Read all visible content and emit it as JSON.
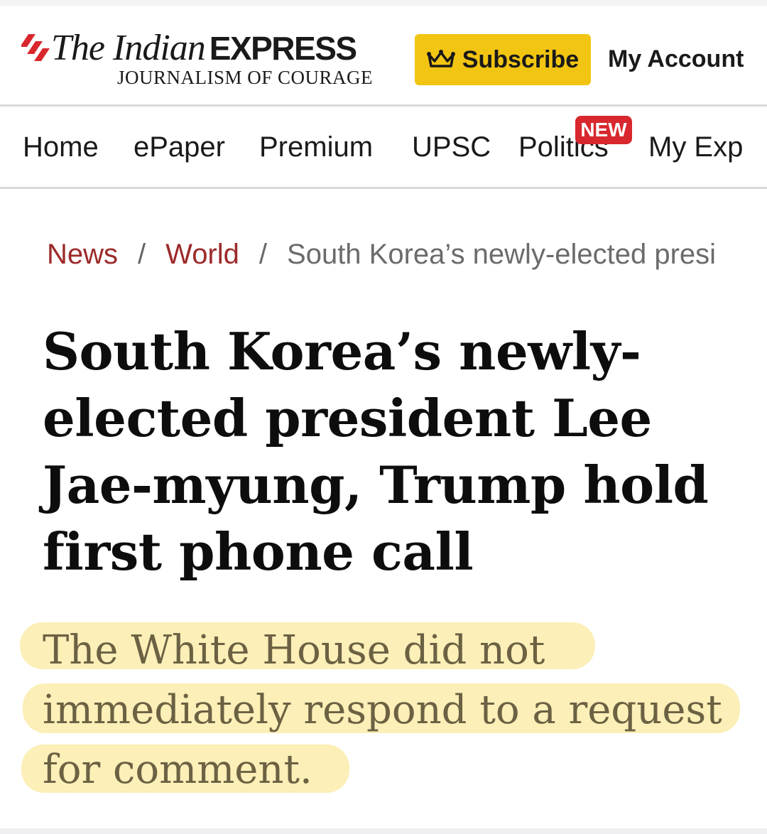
{
  "header": {
    "logo": {
      "the_indian": "The Indian",
      "express": "EXPRESS",
      "tagline": "JOURNALISM OF COURAGE"
    },
    "subscribe_label": "Subscribe",
    "account_label": "My Account"
  },
  "nav": {
    "items": [
      {
        "label": "Home"
      },
      {
        "label": "ePaper"
      },
      {
        "label": "Premium"
      },
      {
        "label": "UPSC"
      },
      {
        "label": "Politics"
      },
      {
        "label": "My Exp"
      }
    ],
    "new_badge": "NEW"
  },
  "breadcrumb": {
    "items": [
      {
        "label": "News"
      },
      {
        "label": "World"
      }
    ],
    "separator": "/",
    "current": "South Korea’s newly-elected presi"
  },
  "article": {
    "headline": "South Korea’s newly-elected president Lee Jae-myung, Trump hold first phone call",
    "standfirst": "The White House did not immediately respond to a request for comment."
  },
  "colors": {
    "brand_red": "#d8272d",
    "subscribe_yellow": "#f2c512",
    "breadcrumb_link": "#9c2a2a",
    "highlight": "#fcefb7"
  },
  "icons": {
    "logo_mark": "express-stripes-icon",
    "subscribe": "crown-icon"
  }
}
